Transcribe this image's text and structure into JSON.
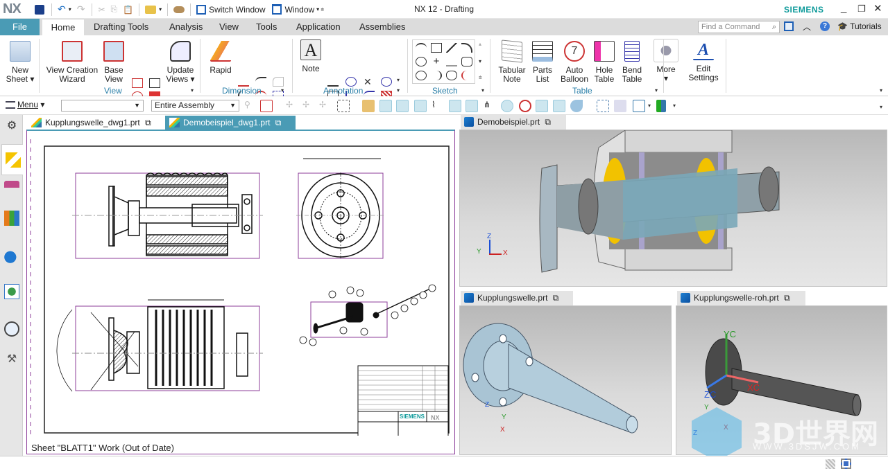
{
  "app": {
    "logo": "NX",
    "title": "NX 12 - Drafting",
    "brand": "SIEMENS",
    "accent_color": "#4a9bb5",
    "brand_color": "#0d9a9a"
  },
  "quick_access": {
    "switch_window": "Switch Window",
    "window": "Window"
  },
  "ribbon_tabs": [
    {
      "label": "File"
    },
    {
      "label": "Home"
    },
    {
      "label": "Drafting Tools"
    },
    {
      "label": "Analysis"
    },
    {
      "label": "View"
    },
    {
      "label": "Tools"
    },
    {
      "label": "Application"
    },
    {
      "label": "Assemblies"
    }
  ],
  "search": {
    "placeholder": "Find a Command"
  },
  "tutorials": "Tutorials",
  "ribbon": {
    "new_sheet": "New Sheet",
    "view_creation_wizard": "View Creation Wizard",
    "base_view": "Base View",
    "update_views": "Update Views",
    "group_view": "View",
    "rapid": "Rapid",
    "group_dimension": "Dimension",
    "note": "Note",
    "group_annotation": "Annotation",
    "group_sketch": "Sketch",
    "tabular_note": "Tabular Note",
    "parts_list": "Parts List",
    "auto_balloon": "Auto Balloon",
    "hole_table": "Hole Table",
    "bend_table": "Bend Table",
    "more": "More",
    "group_table": "Table",
    "edit_settings": "Edit Settings"
  },
  "toolbar2": {
    "menu": "Menu",
    "filter_value": "",
    "scope_value": "Entire Assembly"
  },
  "drawing_tabs": [
    {
      "label": "Kupplungswelle_dwg1.prt",
      "active": false
    },
    {
      "label": "Demobeispiel_dwg1.prt",
      "active": true
    }
  ],
  "sheet_status": "Sheet \"BLATT1\" Work (Out of Date)",
  "title_block": {
    "brand": "SIEMENS",
    "product": "NX"
  },
  "viewports": [
    {
      "label": "Demobeispiel.prt",
      "triad": [
        "Z",
        "Y",
        "X"
      ]
    },
    {
      "label": "Kupplungswelle.prt",
      "triad": [
        "Z",
        "Y",
        "X"
      ]
    },
    {
      "label": "Kupplungswelle-roh.prt",
      "triad": [
        "Y",
        "Z",
        "X"
      ],
      "csys": [
        "YC",
        "ZC",
        "XC"
      ]
    }
  ],
  "watermark": {
    "title": "3D世界网",
    "url": "WWW.3DSJW.COM"
  }
}
